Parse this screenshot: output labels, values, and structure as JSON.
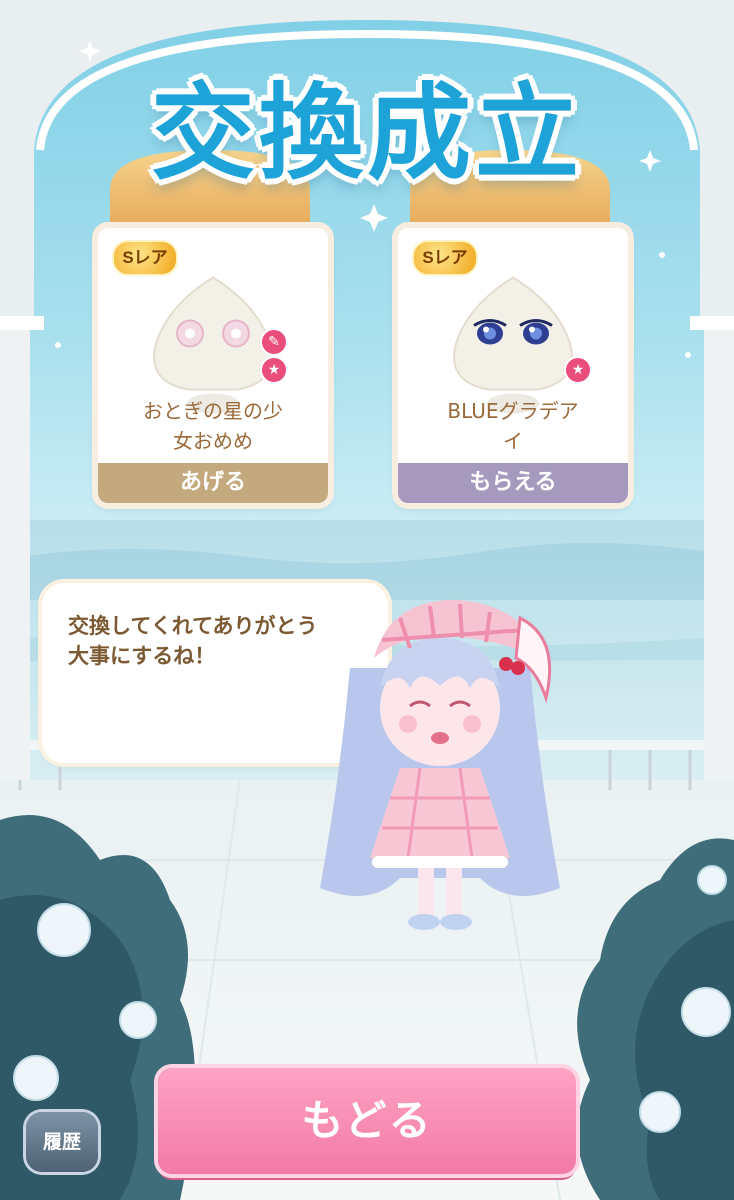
{
  "title": "交換成立",
  "give_card": {
    "rarity": "Sレア",
    "item_name_line1": "おとぎの星の少",
    "item_name_line2": "女おめめ",
    "label": "あげる",
    "badges": [
      "dropper-icon",
      "star-icon"
    ]
  },
  "receive_card": {
    "rarity": "Sレア",
    "item_name_line1": "BLUEグラデア",
    "item_name_line2": "イ",
    "label": "もらえる",
    "badges": [
      "star-icon"
    ]
  },
  "message": {
    "line1": "交換してくれてありがとう",
    "line2": "大事にするね！"
  },
  "buttons": {
    "back": "もどる",
    "history": "履歴"
  },
  "colors": {
    "title": "#1ea3d9",
    "back_button": "#f27aa6",
    "give_label_bg": "#c5a97e",
    "receive_label_bg": "#a59abe",
    "text_brown": "#9b6a3a"
  }
}
